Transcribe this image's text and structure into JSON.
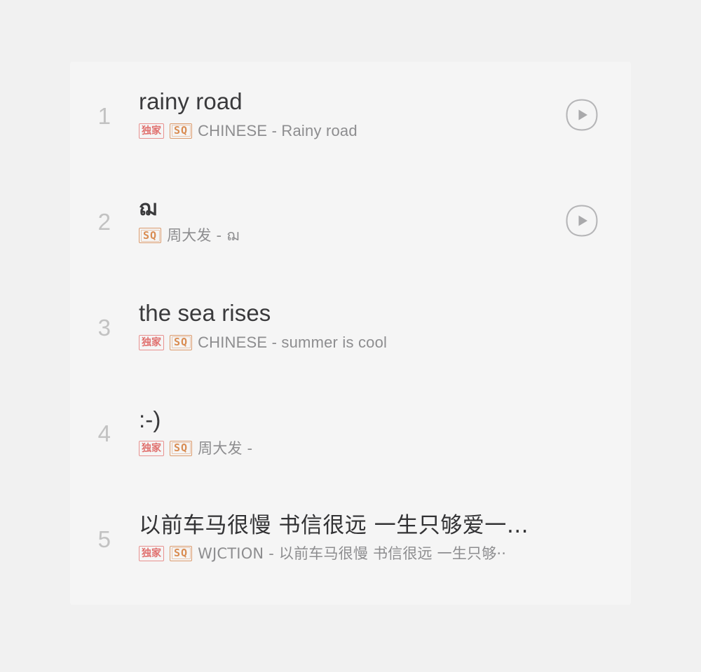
{
  "colors": {
    "page_background": "#f1f1f1",
    "card_background": "#f5f5f5",
    "title_text": "#3a3a3c",
    "subtitle_text": "#8d8d8f",
    "index_text": "#c2c2c2",
    "badge_exclusive": "#e0706e",
    "badge_sq": "#d98c52",
    "play_icon": "#a9a9ab"
  },
  "list": {
    "name": "search-results",
    "rows": [
      {
        "index": "1",
        "title": "rainy road",
        "title_script": "latin",
        "badges": [
          "独家",
          "SQ"
        ],
        "subtitle": "CHINESE - Rainy road",
        "subtitle_script": "latin",
        "has_play_button": true,
        "play_label": "play-rainy-road"
      },
      {
        "index": "2",
        "title": "ฌ",
        "title_script": "glyph",
        "badges": [
          "SQ"
        ],
        "subtitle": "周大发 - ฌ",
        "subtitle_script": "cjk",
        "has_play_button": true,
        "play_label": "play-track-2"
      },
      {
        "index": "3",
        "title": "the sea rises",
        "title_script": "latin",
        "badges": [
          "独家",
          "SQ"
        ],
        "subtitle": "CHINESE - summer is cool",
        "subtitle_script": "latin",
        "has_play_button": false,
        "play_label": ""
      },
      {
        "index": "4",
        "title": ":-)",
        "title_script": "latin",
        "badges": [
          "独家",
          "SQ"
        ],
        "subtitle": "周大发 -",
        "subtitle_script": "cjk",
        "has_play_button": false,
        "play_label": ""
      },
      {
        "index": "5",
        "title": "以前车马很慢 书信很远 一生只够爱一…",
        "title_script": "cjk",
        "badges": [
          "独家",
          "SQ"
        ],
        "subtitle": "WJCTION - 以前车马很慢 书信很远 一生只够··",
        "subtitle_script": "cjk",
        "has_play_button": false,
        "play_label": ""
      }
    ]
  },
  "icons": {
    "play": "play-icon"
  }
}
